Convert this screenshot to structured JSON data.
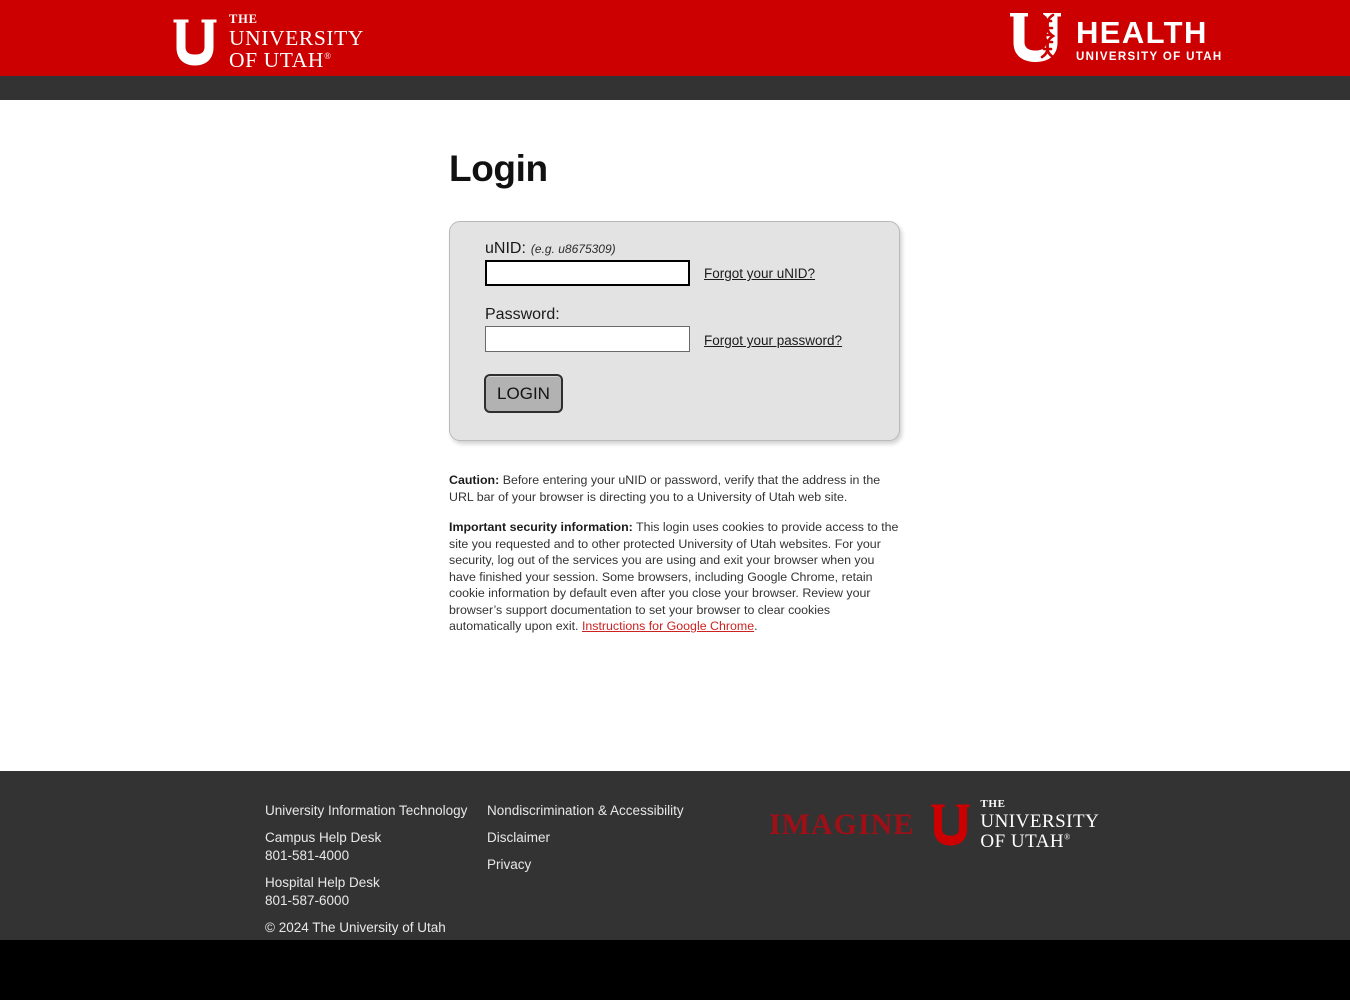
{
  "header": {
    "uofu_logo": {
      "icon": "block-u-icon",
      "the": "THE",
      "line1": "UNIVERSITY",
      "line2": "OF UTAH",
      "registered": "®"
    },
    "health_logo": {
      "icon": "u-health-dna-icon",
      "title": "HEALTH",
      "subtitle": "UNIVERSITY OF UTAH"
    },
    "brand_red": "#cc0000",
    "bar_dark": "#333333"
  },
  "main": {
    "page_title": "Login",
    "form": {
      "unid_label": "uNID:",
      "unid_hint": "(e.g. u8675309)",
      "unid_value": "",
      "unid_placeholder": "",
      "password_label": "Password:",
      "password_value": "",
      "password_placeholder": "",
      "forgot_unid_label": "Forgot your uNID?",
      "forgot_password_label": "Forgot your password?",
      "login_button_label": "LOGIN"
    },
    "notices": {
      "caution_bold": "Caution:",
      "caution_text": " Before entering your uNID or password, verify that the address in the URL bar of your browser is directing you to a University of Utah web site.",
      "security_bold": "Important security information:",
      "security_text": " This login uses cookies to provide access to the site you requested and to other protected University of Utah websites. For your security, log out of the services you are using and exit your browser when you have finished your session. Some browsers, including Google Chrome, retain cookie information by default even after you close your browser. Review your browser’s support documentation to set your browser to clear cookies automatically upon exit. ",
      "chrome_link_label": "Instructions for Google Chrome",
      "security_text_end": "."
    }
  },
  "footer": {
    "column_one": {
      "uit_label": "University Information Technology",
      "campus_help_desk_label": "Campus Help Desk",
      "campus_help_desk_phone": "801-581-4000",
      "hospital_help_desk_label": "Hospital Help Desk",
      "hospital_help_desk_phone": "801-587-6000",
      "copyright": "© 2024 The University of Utah"
    },
    "column_two": {
      "nondiscrimination_label": "Nondiscrimination & Accessibility",
      "disclaimer_label": "Disclaimer",
      "privacy_label": "Privacy"
    },
    "imagine_logo": {
      "word": "IMAGINE",
      "icon": "block-u-icon",
      "the": "THE",
      "line1": "UNIVERSITY",
      "line2": "OF UTAH",
      "registered": "®",
      "word_color": "#9e1018"
    }
  }
}
